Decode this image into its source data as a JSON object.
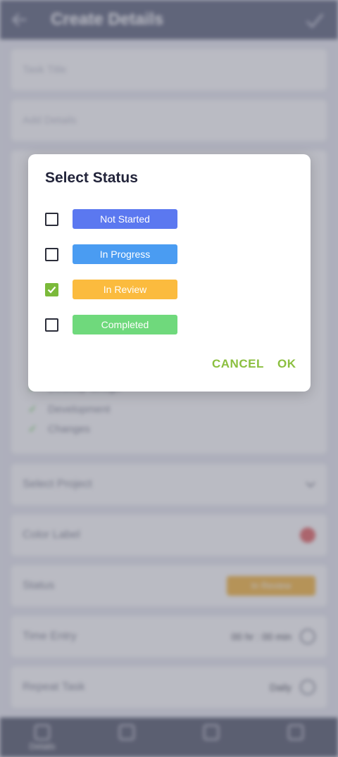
{
  "app": {
    "title": "Create Details",
    "fields": {
      "task_title_placeholder": "Task Title",
      "add_details_placeholder": "Add Details",
      "checklist_items": [
        "Desktop design",
        "Development",
        "Changes"
      ],
      "select_project": "Select Project",
      "color_label": "Color Label",
      "status_label": "Status",
      "status_value": "In Review",
      "time_entry_label": "Time Entry",
      "time_entry_value": "00 hr : 00 min",
      "repeat_task_label": "Repeat Task",
      "repeat_task_value": "Daily"
    },
    "bottom_nav": [
      {
        "label": "Details",
        "icon": "details-icon"
      },
      {
        "label": "",
        "icon": "chat-icon"
      },
      {
        "label": "",
        "icon": "calendar-icon"
      },
      {
        "label": "",
        "icon": "attachment-icon"
      }
    ],
    "colors": {
      "appbar": "#535a74",
      "accent": "#8bbf3f"
    }
  },
  "dialog": {
    "title": "Select Status",
    "options": [
      {
        "label": "Not Started",
        "color": "#5b78f0",
        "checked": false
      },
      {
        "label": "In Progress",
        "color": "#4a9cf2",
        "checked": false
      },
      {
        "label": "In Review",
        "color": "#fbbb3e",
        "checked": true
      },
      {
        "label": "Completed",
        "color": "#6fd97c",
        "checked": false
      }
    ],
    "cancel_label": "CANCEL",
    "ok_label": "OK"
  }
}
